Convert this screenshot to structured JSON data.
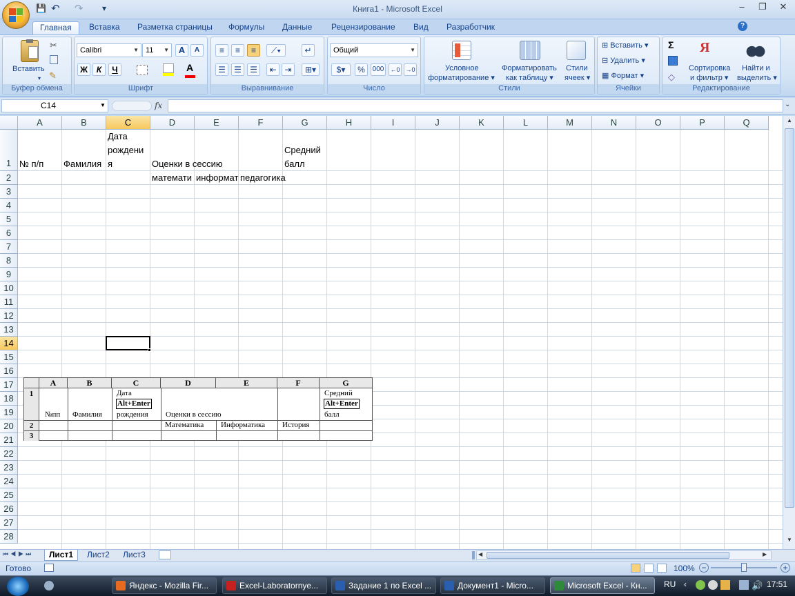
{
  "window": {
    "title": "Книга1 - Microsoft Excel",
    "controls": {
      "minimize": "–",
      "restore": "❐",
      "close": "✕"
    }
  },
  "quick_access": {
    "save": "💾",
    "undo": "↶",
    "redo": "↷",
    "more": "▾"
  },
  "ribbon_tabs": [
    "Главная",
    "Вставка",
    "Разметка страницы",
    "Формулы",
    "Данные",
    "Рецензирование",
    "Вид",
    "Разработчик"
  ],
  "active_tab": "Главная",
  "ribbon": {
    "clipboard": {
      "paste": "Вставить",
      "label": "Буфер обмена"
    },
    "font": {
      "name": "Calibri",
      "size": "11",
      "bold": "Ж",
      "italic": "К",
      "underline": "Ч",
      "grow": "A",
      "shrink": "A",
      "color": "A",
      "label": "Шрифт"
    },
    "alignment": {
      "label": "Выравнивание"
    },
    "number": {
      "format": "Общий",
      "percent": "%",
      "thousands": "000",
      "label": "Число"
    },
    "styles": {
      "conditional": "Условное форматирование",
      "conditional_l1": "Условное",
      "conditional_l2": "форматирование",
      "table_l1": "Форматировать",
      "table_l2": "как таблицу",
      "cell_l1": "Стили",
      "cell_l2": "ячеек",
      "label": "Стили"
    },
    "cells": {
      "insert": "Вставить",
      "delete": "Удалить",
      "format": "Формат",
      "label": "Ячейки"
    },
    "editing": {
      "sigma": "Σ",
      "sort_l1": "Сортировка",
      "sort_l2": "и фильтр",
      "find_l1": "Найти и",
      "find_l2": "выделить",
      "label": "Редактирование"
    }
  },
  "formula_bar": {
    "name_box": "C14",
    "fx": "fx",
    "value": ""
  },
  "columns": [
    "A",
    "B",
    "C",
    "D",
    "E",
    "F",
    "G",
    "H",
    "I",
    "J",
    "K",
    "L",
    "M",
    "N",
    "O",
    "P",
    "Q"
  ],
  "rows": [
    "1",
    "2",
    "3",
    "4",
    "5",
    "6",
    "7",
    "8",
    "9",
    "10",
    "11",
    "12",
    "13",
    "14",
    "15",
    "16",
    "17",
    "18",
    "19",
    "20",
    "21",
    "22",
    "23",
    "24",
    "25",
    "26",
    "27",
    "28"
  ],
  "selected_cell": {
    "col": "C",
    "row": "14"
  },
  "cells": {
    "A1": "№ п/п",
    "B1": "Фамилия",
    "C1_l1": "Дата",
    "C1_l2": "рождени",
    "C1_l3": "я",
    "D1": "Оценки в сессию",
    "G1_l1": "Средний",
    "G1_l2": "балл",
    "D2": "математи",
    "E2": "информат",
    "F2": "педагогика"
  },
  "picture": {
    "col_headers": [
      "A",
      "B",
      "C",
      "D",
      "E",
      "F",
      "G"
    ],
    "row_headers": [
      "1",
      "2",
      "3"
    ],
    "a": "№пп",
    "b": "Фамилия",
    "c_top": "Дата",
    "c_box": "Alt+Enter",
    "c_bottom": "рождения",
    "d": "Оценки в сессию",
    "g_top": "Средний",
    "g_box": "Alt+Enter",
    "g_bottom": "балл",
    "sub1": "Математика",
    "sub2": "Информатика",
    "sub3": "История"
  },
  "sheets": [
    "Лист1",
    "Лист2",
    "Лист3"
  ],
  "active_sheet": "Лист1",
  "status": {
    "ready": "Готово",
    "zoom": "100%"
  },
  "taskbar": {
    "items": [
      "Яндекс - Mozilla Fir...",
      "Excel-Laboratornye...",
      "Задание 1 по Excel ...",
      "Документ1 - Micro...",
      "Microsoft Excel - Кн..."
    ],
    "lang": "RU",
    "time": "17:51"
  }
}
